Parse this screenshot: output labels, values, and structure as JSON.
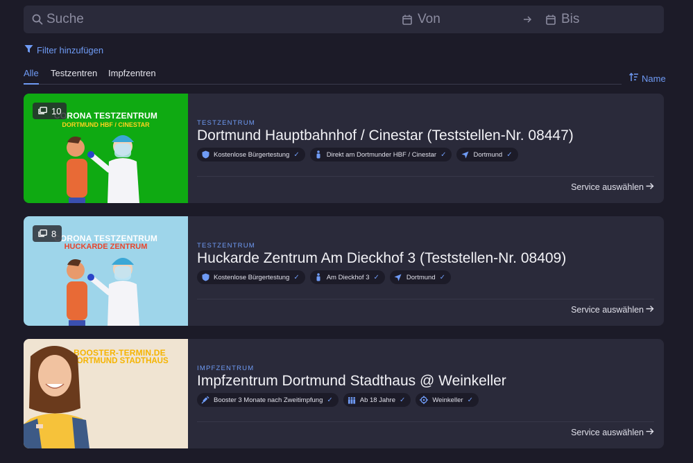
{
  "search": {
    "placeholder": "Suche",
    "from_placeholder": "Von",
    "to_placeholder": "Bis"
  },
  "filter": {
    "label": "Filter hinzufügen"
  },
  "tabs": [
    {
      "label": "Alle",
      "active": true
    },
    {
      "label": "Testzentren",
      "active": false
    },
    {
      "label": "Impfzentren",
      "active": false
    }
  ],
  "sort": {
    "label": "Name"
  },
  "colors": {
    "accent": "#6f9bf5",
    "background": "#1c1b28",
    "card": "#2a2a3a"
  },
  "cards": [
    {
      "image_count": "10",
      "image": {
        "line1": "CORONA TESTZENTRUM",
        "line2": "DORTMUND HBF / CINESTAR",
        "bg": "#0faa12"
      },
      "category": "TESTZENTRUM",
      "title": "Dortmund Hauptbahnhof / Cinestar (Teststellen-Nr. 08447)",
      "chips": [
        {
          "icon": "shield-icon",
          "label": "Kostenlose Bürgertestung"
        },
        {
          "icon": "person-icon",
          "label": "Direkt am Dortmunder HBF / Cinestar"
        },
        {
          "icon": "navigation-icon",
          "label": "Dortmund"
        }
      ],
      "action": "Service auswählen"
    },
    {
      "image_count": "8",
      "image": {
        "line1": "CORONA TESTZENTRUM",
        "line2": "HUCKARDE ZENTRUM",
        "bg": "#9ed5ea"
      },
      "category": "TESTZENTRUM",
      "title": "Huckarde Zentrum Am Dieckhof 3 (Teststellen-Nr. 08409)",
      "chips": [
        {
          "icon": "shield-icon",
          "label": "Kostenlose Bürgertestung"
        },
        {
          "icon": "person-icon",
          "label": "Am Dieckhof 3"
        },
        {
          "icon": "navigation-icon",
          "label": "Dortmund"
        }
      ],
      "action": "Service auswählen"
    },
    {
      "image": {
        "line1": "BOOSTER-TERMIN.DE",
        "line2": "DORTMUND STADTHAUS",
        "bg": "#f0e4d2"
      },
      "category": "IMPFZENTRUM",
      "title": "Impfzentrum Dortmund Stadthaus @ Weinkeller",
      "chips": [
        {
          "icon": "syringe-icon",
          "label": "Booster 3 Monate nach Zweitimpfung"
        },
        {
          "icon": "people-icon",
          "label": "Ab 18 Jahre"
        },
        {
          "icon": "crosshair-icon",
          "label": "Weinkeller"
        }
      ],
      "action": "Service auswählen"
    }
  ]
}
